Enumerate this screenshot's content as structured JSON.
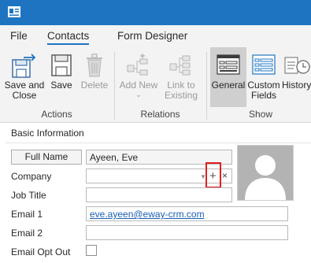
{
  "ribbon_tabs": [
    "File",
    "Contacts",
    "Form Designer"
  ],
  "ribbon": {
    "actions": {
      "save_and_close": "Save and\nClose",
      "save": "Save",
      "delete": "Delete",
      "group": "Actions"
    },
    "relations": {
      "add_new": "Add New",
      "link_to_existing": "Link to\nExisting",
      "group": "Relations"
    },
    "show": {
      "general": "General",
      "custom_fields": "Custom\nFields",
      "history": "History",
      "group": "Show"
    }
  },
  "form": {
    "section_title": "Basic Information",
    "full_name_button": "Full Name",
    "full_name_value": "Ayeen, Eve",
    "company_label": "Company",
    "company_value": "",
    "add_icon": "+",
    "clear_icon": "×",
    "dropdown_icon": "▼",
    "job_title_label": "Job Title",
    "job_title_value": "",
    "email1_label": "Email 1",
    "email1_value": "eve.ayeen@eway-crm.com",
    "email2_label": "Email 2",
    "email2_value": "",
    "email_opt_out_label": "Email Opt Out",
    "email_opt_out_checked": false
  },
  "colors": {
    "titlebar": "#1f74c2",
    "ribbon": "#f3f3f3",
    "highlight": "#e02020",
    "link": "#1a5fb4"
  }
}
